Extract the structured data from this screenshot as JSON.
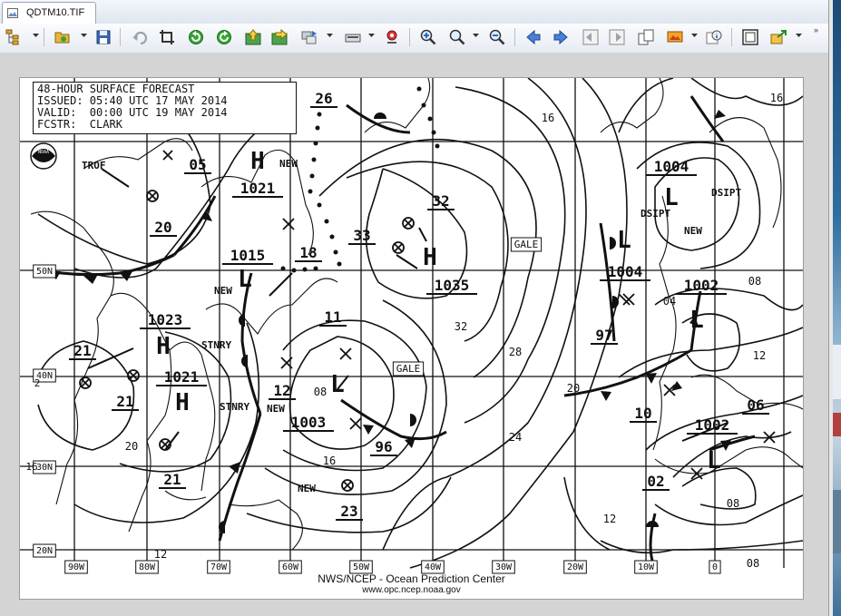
{
  "tab": {
    "title": "QDTM10.TIF",
    "icon": "image-file-icon"
  },
  "toolbar": {
    "buttons": [
      {
        "name": "browse-tree-button",
        "icon": "tree-icon"
      },
      {
        "name": "open-folder-button",
        "icon": "folder-open-icon"
      },
      {
        "name": "save-button",
        "icon": "floppy-disk-icon"
      },
      {
        "name": "undo-button",
        "icon": "undo-icon"
      },
      {
        "name": "crop-button",
        "icon": "crop-icon"
      },
      {
        "name": "rotate-left-button",
        "icon": "rotate-left-icon"
      },
      {
        "name": "rotate-right-button",
        "icon": "rotate-right-icon"
      },
      {
        "name": "flip-vertical-button",
        "icon": "flip-vertical-icon"
      },
      {
        "name": "flip-horizontal-button",
        "icon": "flip-horizontal-icon"
      },
      {
        "name": "batch-convert-button",
        "icon": "batch-icon"
      },
      {
        "name": "scanner-button",
        "icon": "scanner-icon"
      },
      {
        "name": "red-eye-button",
        "icon": "red-eye-icon"
      },
      {
        "name": "zoom-in-button",
        "icon": "zoom-in-icon"
      },
      {
        "name": "zoom-button",
        "icon": "magnifier-icon"
      },
      {
        "name": "zoom-out-button",
        "icon": "zoom-out-icon"
      },
      {
        "name": "previous-button",
        "icon": "arrow-left-icon"
      },
      {
        "name": "next-button",
        "icon": "arrow-right-icon"
      },
      {
        "name": "first-page-button",
        "icon": "first-page-icon"
      },
      {
        "name": "last-page-button",
        "icon": "last-page-icon"
      },
      {
        "name": "copy-button",
        "icon": "copy-icon"
      },
      {
        "name": "slideshow-button",
        "icon": "slideshow-icon"
      },
      {
        "name": "info-button",
        "icon": "info-icon"
      },
      {
        "name": "fit-window-button",
        "icon": "fit-window-icon"
      },
      {
        "name": "export-button",
        "icon": "export-icon"
      }
    ],
    "overflow": "»"
  },
  "map": {
    "header": {
      "line1": "48-HOUR SURFACE FORECAST",
      "line2": "ISSUED: 05:40 UTC 17 MAY 2014",
      "line3": "VALID:  00:00 UTC 19 MAY 2014",
      "line4": "FCSTR:  CLARK"
    },
    "credit1": "NWS/NCEP - Ocean Prediction Center",
    "credit2": "www.opc.ncep.noaa.gov",
    "logo": "NOAA",
    "lon_labels": [
      "90W",
      "80W",
      "70W",
      "60W",
      "50W",
      "40W",
      "30W",
      "20W",
      "10W",
      "0"
    ],
    "lat_labels": [
      "50N",
      "40N",
      "30N",
      "20N"
    ],
    "lat_partial": "2",
    "systems": [
      {
        "sym": "H",
        "val": "1021"
      },
      {
        "sym": "H",
        "val": "1023",
        "note": "STNRY"
      },
      {
        "sym": "H",
        "val": "1021",
        "note": "STNRY"
      },
      {
        "sym": "H",
        "val": "1035"
      },
      {
        "sym": "L",
        "val": "1015",
        "note": "NEW"
      },
      {
        "sym": "L",
        "val": "1003"
      },
      {
        "sym": "L",
        "val": "1004",
        "note": "DSIPT"
      },
      {
        "sym": "L",
        "val": "1004",
        "note": "DSIPT"
      },
      {
        "sym": "L",
        "val": "1002"
      },
      {
        "sym": "L",
        "val": "1002"
      }
    ],
    "notes": {
      "trof": "TROF",
      "new": "NEW",
      "stnry": "STNRY",
      "dsipt": "DSIPT",
      "gale": "GALE"
    },
    "isobar_labels": [
      "26",
      "05",
      "20",
      "18",
      "33",
      "32",
      "11",
      "21",
      "21",
      "12",
      "08",
      "96",
      "23",
      "21",
      "16",
      "97",
      "10",
      "02",
      "06",
      "20",
      "24",
      "28",
      "32",
      "16",
      "16",
      "04",
      "08",
      "12",
      "08",
      "12",
      "08",
      "12",
      "20",
      "16"
    ]
  }
}
